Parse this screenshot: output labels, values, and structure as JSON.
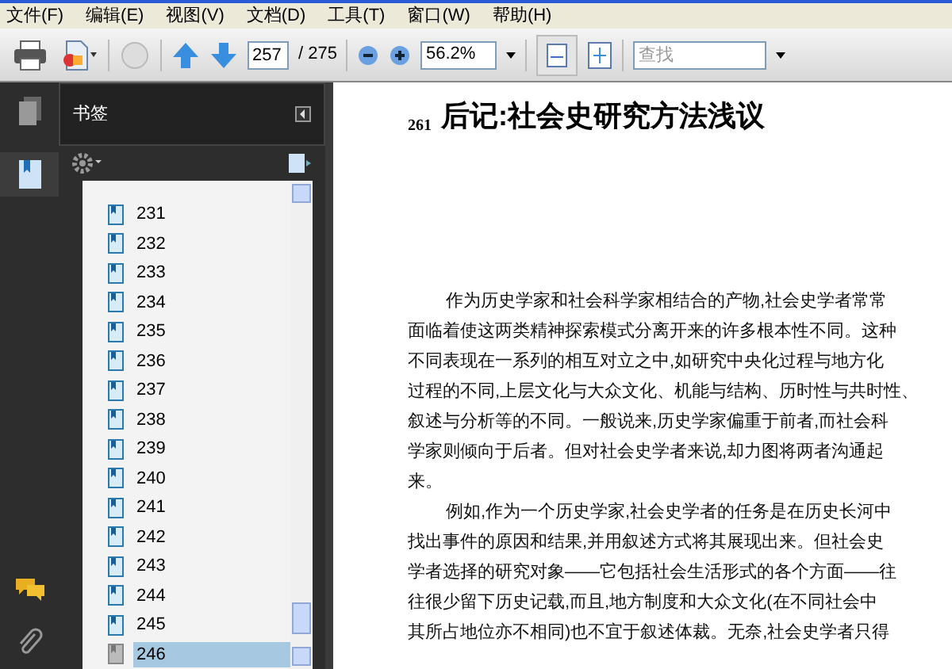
{
  "menu": [
    "文件(F)",
    "编辑(E)",
    "视图(V)",
    "文档(D)",
    "工具(T)",
    "窗口(W)",
    "帮助(H)"
  ],
  "toolbar": {
    "page_number": "257",
    "page_total": "/ 275",
    "zoom": "56.2%",
    "search": {
      "placeholder": "查找"
    }
  },
  "bookmarks_panel": {
    "title": "书签",
    "items": [
      {
        "label": "231",
        "selected": false
      },
      {
        "label": "232",
        "selected": false
      },
      {
        "label": "233",
        "selected": false
      },
      {
        "label": "234",
        "selected": false
      },
      {
        "label": "235",
        "selected": false
      },
      {
        "label": "236",
        "selected": false
      },
      {
        "label": "237",
        "selected": false
      },
      {
        "label": "238",
        "selected": false
      },
      {
        "label": "239",
        "selected": false
      },
      {
        "label": "240",
        "selected": false
      },
      {
        "label": "241",
        "selected": false
      },
      {
        "label": "242",
        "selected": false
      },
      {
        "label": "243",
        "selected": false
      },
      {
        "label": "244",
        "selected": false
      },
      {
        "label": "245",
        "selected": false
      },
      {
        "label": "246",
        "selected": true
      }
    ]
  },
  "document": {
    "page_label": "261",
    "heading": "后记:社会史研究方法浅议",
    "lines": [
      {
        "text": "作为历史学家和社会科学家相结合的产物,社会史学者常常",
        "indent": true
      },
      {
        "text": "面临着使这两类精神探索模式分离开来的许多根本性不同。这种",
        "indent": false
      },
      {
        "text": "不同表现在一系列的相互对立之中,如研究中央化过程与地方化",
        "indent": false
      },
      {
        "text": "过程的不同,上层文化与大众文化、机能与结构、历时性与共时性、",
        "indent": false
      },
      {
        "text": "叙述与分析等的不同。一般说来,历史学家偏重于前者,而社会科",
        "indent": false
      },
      {
        "text": "学家则倾向于后者。但对社会史学者来说,却力图将两者沟通起",
        "indent": false
      },
      {
        "text": "来。",
        "indent": false
      },
      {
        "text": "例如,作为一个历史学家,社会史学者的任务是在历史长河中",
        "indent": true
      },
      {
        "text": "找出事件的原因和结果,并用叙述方式将其展现出来。但社会史",
        "indent": false
      },
      {
        "text": "学者选择的研究对象——它包括社会生活形式的各个方面——往",
        "indent": false
      },
      {
        "text": "往很少留下历史记载,而且,地方制度和大众文化(在不同社会中",
        "indent": false
      },
      {
        "text": "其所占地位亦不相同)也不宜于叙述体裁。无奈,社会史学者只得",
        "indent": false
      }
    ]
  }
}
